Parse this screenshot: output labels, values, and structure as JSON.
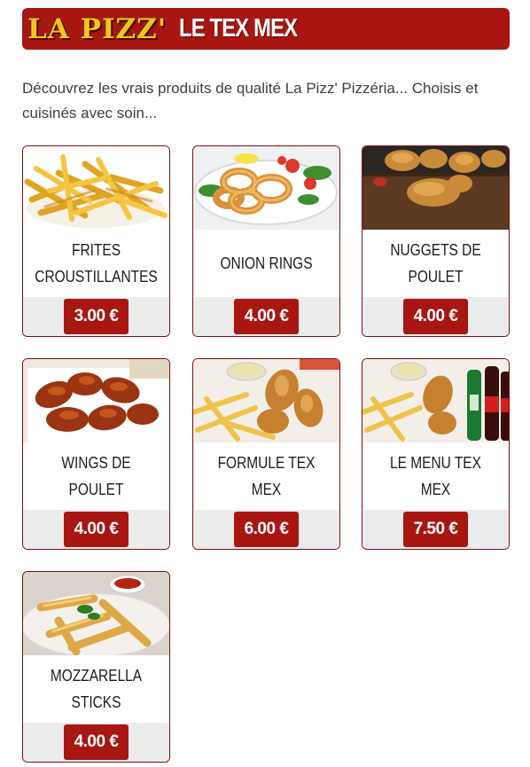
{
  "header": {
    "logo_text": "LA PIZZ'",
    "section_title": "LE TEX MEX",
    "accent_color": "#a81612",
    "logo_color": "#f2c51b"
  },
  "intro": {
    "text": "Découvrez les vrais produits de qualité La Pizz' Pizzéria... Choisis et cuisinés avec soin..."
  },
  "products": [
    {
      "name": "FRITES CROUSTILLANTES",
      "price": "3.00 €",
      "image": "fries-photo"
    },
    {
      "name": "ONION RINGS",
      "price": "4.00 €",
      "image": "onion-rings-photo"
    },
    {
      "name": "NUGGETS DE POULET",
      "price": "4.00 €",
      "image": "chicken-nuggets-photo"
    },
    {
      "name": "WINGS DE POULET",
      "price": "4.00 €",
      "image": "chicken-wings-photo"
    },
    {
      "name": "FORMULE TEX MEX",
      "price": "6.00 €",
      "image": "tex-mex-combo-photo"
    },
    {
      "name": "LE MENU TEX MEX",
      "price": "7.50 €",
      "image": "tex-mex-menu-photo"
    },
    {
      "name": "MOZZARELLA STICKS",
      "price": "4.00 €",
      "image": "mozzarella-sticks-photo"
    }
  ]
}
